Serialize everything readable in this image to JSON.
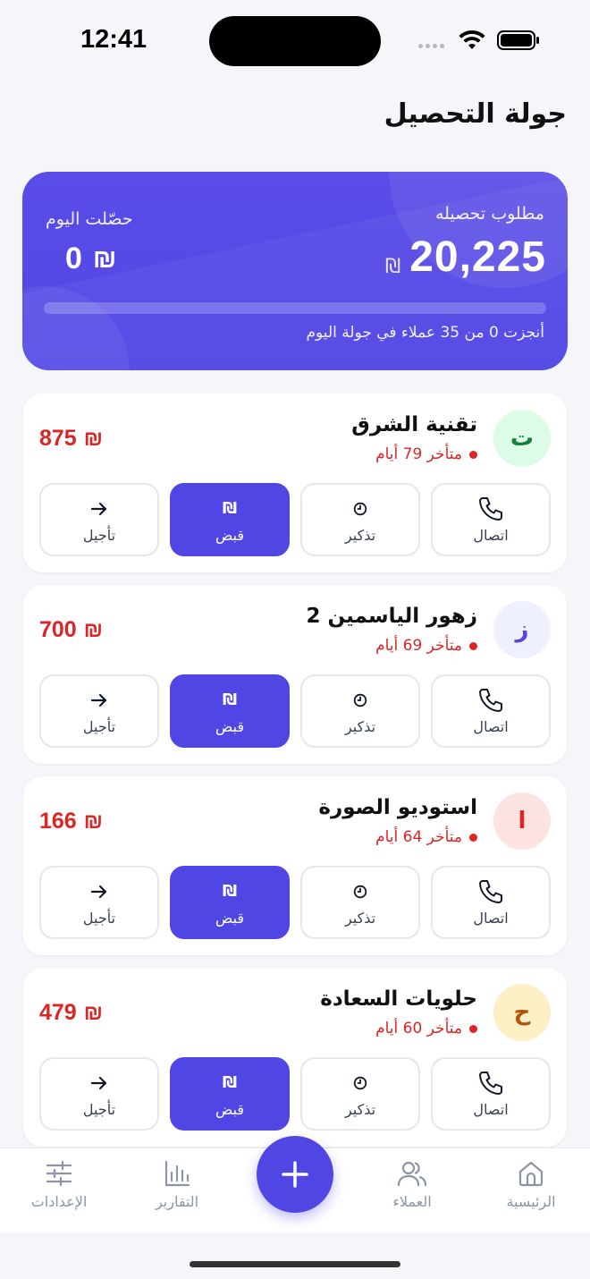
{
  "status_bar": {
    "time": "12:41"
  },
  "header": {
    "title": "جولة التحصيل"
  },
  "summary": {
    "required_label": "مطلوب تحصيله",
    "required_amount": "20,225",
    "collected_label": "حصّلت اليوم",
    "collected_amount": "0",
    "currency": "₪",
    "progress_fraction": 0,
    "progress_text": "أنجزت 0 من 35 عملاء في جولة اليوم"
  },
  "actions": {
    "call": "اتصال",
    "remind": "تذكير",
    "collect": "قبض",
    "defer": "تأجيل"
  },
  "customers": [
    {
      "initial": "ت",
      "name": "تقنية الشرق",
      "overdue": "متأخر 79 أيام",
      "amount": "875",
      "avatar_bg": "#dcfce7",
      "avatar_fg": "#15803d"
    },
    {
      "initial": "ز",
      "name": "زهور الياسمين 2",
      "overdue": "متأخر 69 أيام",
      "amount": "700",
      "avatar_bg": "#eef0ff",
      "avatar_fg": "#4f46e5"
    },
    {
      "initial": "ا",
      "name": "استوديو الصورة",
      "overdue": "متأخر 64 أيام",
      "amount": "166",
      "avatar_bg": "#fde2e2",
      "avatar_fg": "#dc2626"
    },
    {
      "initial": "ح",
      "name": "حلويات السعادة",
      "overdue": "متأخر 60 أيام",
      "amount": "479",
      "avatar_bg": "#fdf0c7",
      "avatar_fg": "#b45309"
    }
  ],
  "bottom_nav": {
    "home": "الرئيسية",
    "clients": "العملاء",
    "reports": "التقارير",
    "settings": "الإعدادات"
  },
  "colors": {
    "accent": "#5046e4",
    "danger": "#dc2626",
    "muted": "#8b95a7"
  }
}
